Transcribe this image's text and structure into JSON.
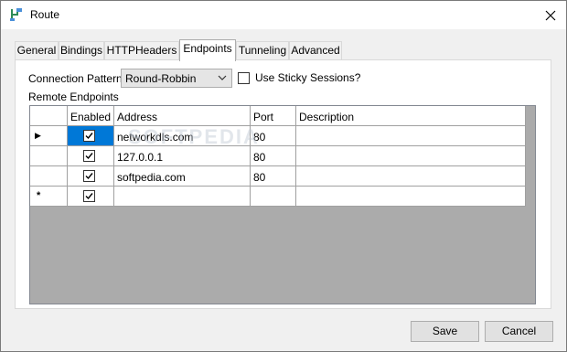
{
  "window": {
    "title": "Route"
  },
  "tabs": [
    "General",
    "Bindings",
    "HTTPHeaders",
    "Endpoints",
    "Tunneling",
    "Advanced"
  ],
  "active_tab": "Endpoints",
  "form": {
    "connection_pattern_label": "Connection Pattern",
    "connection_pattern_value": "Round-Robbin",
    "sticky_label": "Use Sticky Sessions?",
    "sticky_checked": false,
    "remote_endpoints_label": "Remote Endpoints"
  },
  "grid": {
    "columns": [
      "Enabled",
      "Address",
      "Port",
      "Description"
    ],
    "rows": [
      {
        "enabled": true,
        "address": "networkdls.com",
        "port": "80",
        "description": ""
      },
      {
        "enabled": true,
        "address": "127.0.0.1",
        "port": "80",
        "description": ""
      },
      {
        "enabled": true,
        "address": "softpedia.com",
        "port": "80",
        "description": ""
      },
      {
        "enabled": true,
        "address": "",
        "port": "",
        "description": ""
      }
    ],
    "current_row_marker": "▶",
    "new_row_marker": "*"
  },
  "watermark": "SOFTPEDIA",
  "buttons": {
    "save": "Save",
    "cancel": "Cancel"
  },
  "colors": {
    "selection": "#0078d7",
    "accent": "#2e8b57"
  }
}
